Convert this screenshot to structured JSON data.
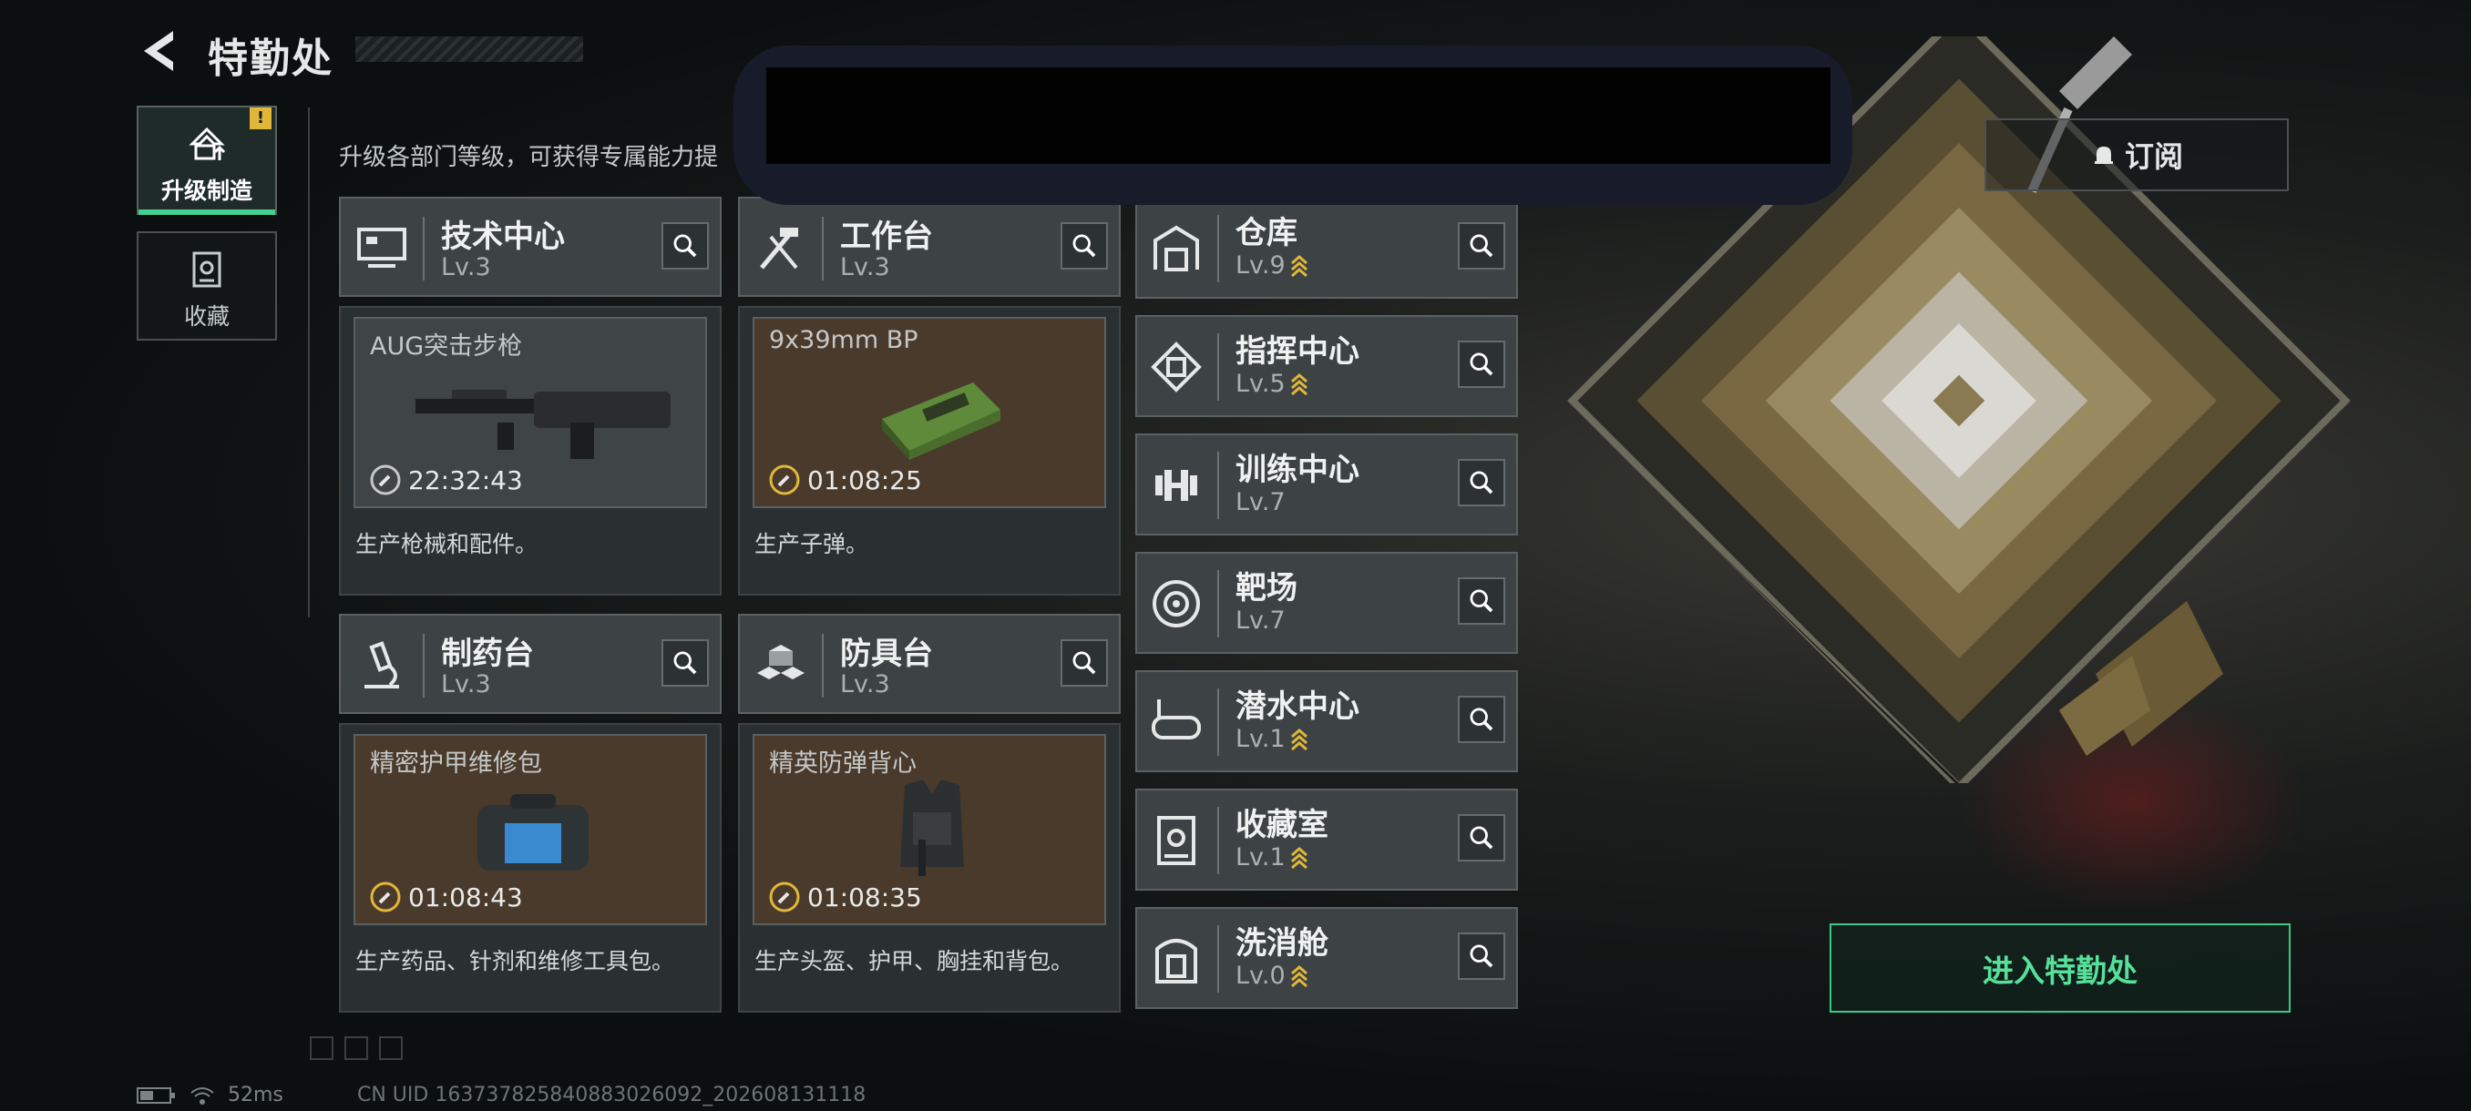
{
  "header": {
    "title": "特勤处"
  },
  "sidebar": {
    "tabs": [
      {
        "label": "升级制造",
        "badge": "!"
      },
      {
        "label": "收藏"
      }
    ]
  },
  "intro_text": "升级各部门等级，可获得专属能力提",
  "workshops": [
    {
      "name": "技术中心",
      "level": "Lv.3",
      "item": "AUG突击步枪",
      "timer": "22:32:43",
      "desc": "生产枪械和配件。"
    },
    {
      "name": "工作台",
      "level": "Lv.3",
      "item": "9x39mm BP",
      "timer": "01:08:25",
      "desc": "生产子弹。"
    },
    {
      "name": "制药台",
      "level": "Lv.3",
      "item": "精密护甲维修包",
      "timer": "01:08:43",
      "desc": "生产药品、针剂和维修工具包。"
    },
    {
      "name": "防具台",
      "level": "Lv.3",
      "item": "精英防弹背心",
      "timer": "01:08:35",
      "desc": "生产头盔、护甲、胸挂和背包。"
    }
  ],
  "departments": [
    {
      "name": "仓库",
      "level": "Lv.9",
      "upgrade": true
    },
    {
      "name": "指挥中心",
      "level": "Lv.5",
      "upgrade": true
    },
    {
      "name": "训练中心",
      "level": "Lv.7",
      "upgrade": false
    },
    {
      "name": "靶场",
      "level": "Lv.7",
      "upgrade": false
    },
    {
      "name": "潜水中心",
      "level": "Lv.1",
      "upgrade": true
    },
    {
      "name": "收藏室",
      "level": "Lv.1",
      "upgrade": true
    },
    {
      "name": "洗消舱",
      "level": "Lv.0",
      "upgrade": true
    }
  ],
  "buttons": {
    "subscribe": "订阅",
    "enter": "进入特勤处"
  },
  "status": {
    "ping": "52ms",
    "uid": "CN UID 1637378258408830260​92_202608131118"
  },
  "colors": {
    "accent": "#42d08f",
    "upgrade": "#e1b73a"
  }
}
